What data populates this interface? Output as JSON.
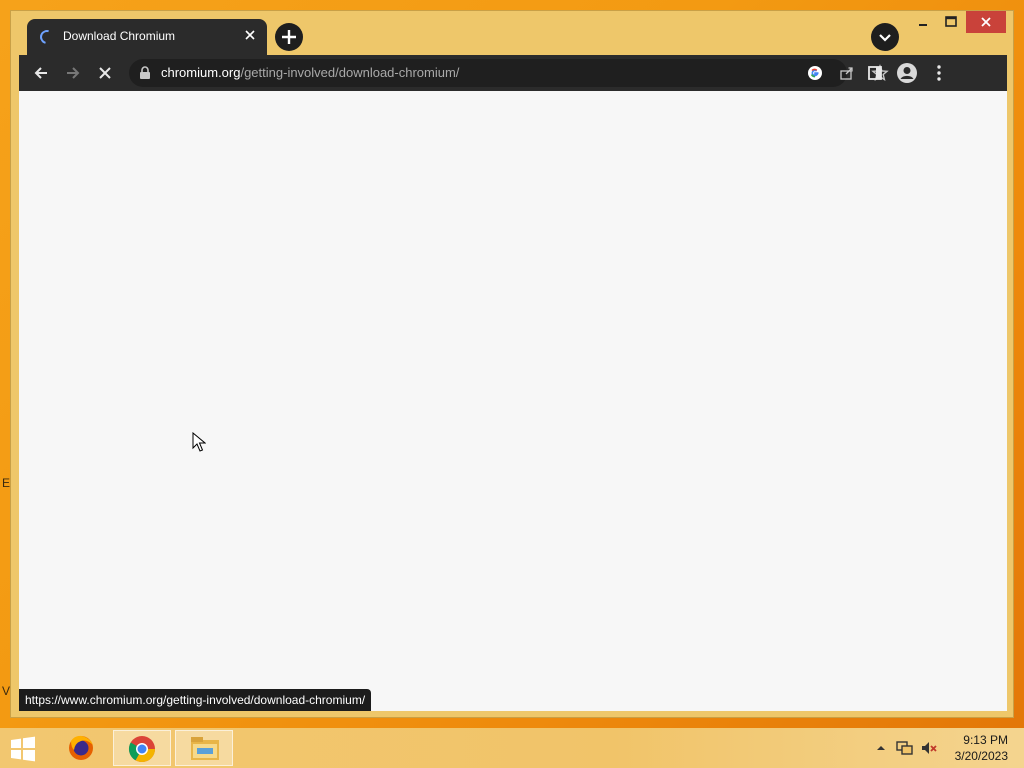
{
  "desktop": {
    "edge_letters": [
      "E",
      "V"
    ]
  },
  "browser": {
    "tab": {
      "title": "Download Chromium",
      "loading": true
    },
    "toolbar": {
      "url_host": "chromium.org",
      "url_path": "/getting-involved/download-chromium/"
    },
    "status_bar": {
      "link_url": "https://www.chromium.org/getting-involved/download-chromium/"
    }
  },
  "taskbar": {
    "apps": [
      {
        "name": "Firefox",
        "active": false
      },
      {
        "name": "Google Chrome",
        "active": true
      },
      {
        "name": "File Explorer",
        "active": false
      }
    ],
    "clock": {
      "time": "9:13 PM",
      "date": "3/20/2023"
    }
  },
  "colors": {
    "desktop_bg": "#f39a12",
    "window_frame": "#eec76a",
    "browser_dark": "#2b2b2b",
    "close_button": "#c9423a",
    "page_bg": "#f7f7f7"
  }
}
